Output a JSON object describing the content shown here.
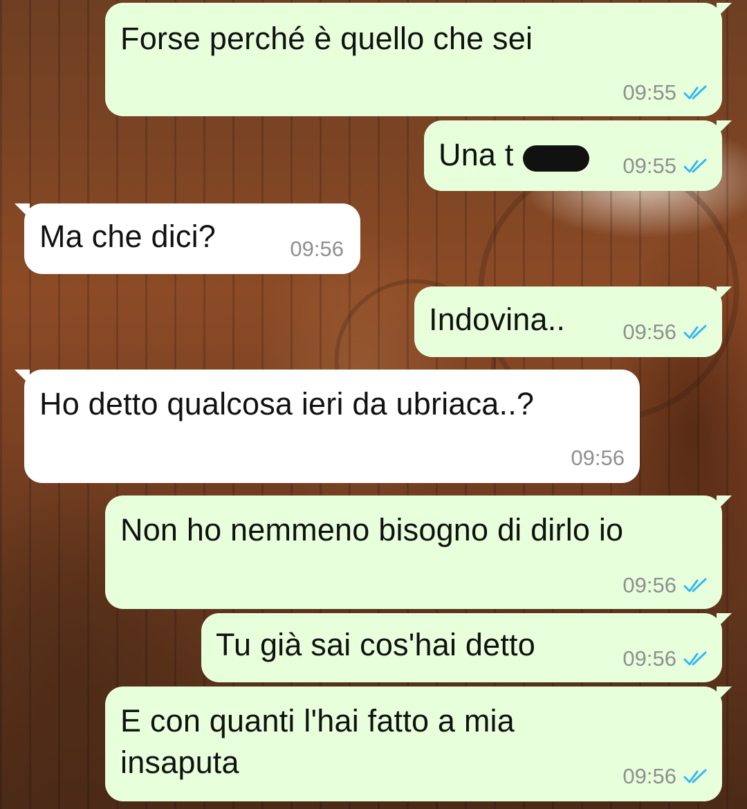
{
  "conversation": {
    "messages": [
      {
        "direction": "outgoing",
        "text": "Forse perché è quello che sei",
        "time": "09:55",
        "status": "read"
      },
      {
        "direction": "outgoing",
        "text": "Una t",
        "redacted": true,
        "time": "09:55",
        "status": "read"
      },
      {
        "direction": "incoming",
        "text": "Ma che dici?",
        "time": "09:56"
      },
      {
        "direction": "outgoing",
        "text": "Indovina..",
        "time": "09:56",
        "status": "read"
      },
      {
        "direction": "incoming",
        "text": "Ho detto qualcosa ieri da ubriaca..?",
        "time": "09:56"
      },
      {
        "direction": "outgoing",
        "text": "Non ho nemmeno bisogno di dirlo io",
        "time": "09:56",
        "status": "read"
      },
      {
        "direction": "outgoing",
        "text": "Tu già sai cos'hai detto",
        "time": "09:56",
        "status": "read"
      },
      {
        "direction": "outgoing",
        "text": "E con quanti l'hai fatto a mia\ninsaputa",
        "time": "09:56",
        "status": "read"
      }
    ]
  },
  "icons": {
    "read_receipt": "double-check-icon",
    "read_receipt_color": "#34b7f1"
  },
  "colors": {
    "outgoing_bubble": "#e7ffdb",
    "incoming_bubble": "#ffffff",
    "timestamp": "#8f8f8f"
  }
}
